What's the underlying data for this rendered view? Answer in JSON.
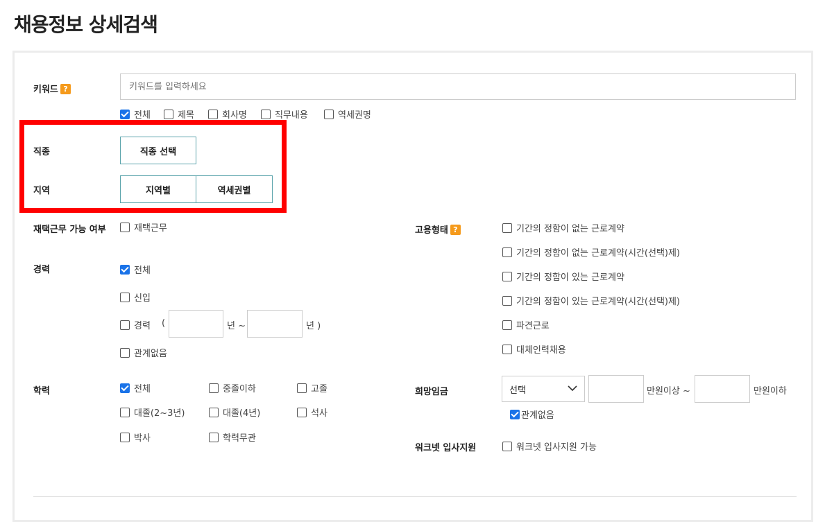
{
  "page_title": "채용정보 상세검색",
  "keyword": {
    "label": "키워드",
    "help": "?",
    "placeholder": "키워드를 입력하세요",
    "options": [
      {
        "label": "전체",
        "checked": true
      },
      {
        "label": "제목",
        "checked": false
      },
      {
        "label": "회사명",
        "checked": false
      },
      {
        "label": "직무내용",
        "checked": false
      },
      {
        "label": "역세권명",
        "checked": false
      }
    ]
  },
  "job_type": {
    "label": "직종",
    "button": "직종 선택"
  },
  "region": {
    "label": "지역",
    "by_region": "지역별",
    "by_station": "역세권별"
  },
  "remote": {
    "label": "재택근무 가능 여부",
    "option": "재택근무",
    "checked": false
  },
  "career": {
    "label": "경력",
    "all": "전체",
    "new": "신입",
    "experienced": "경력",
    "paren_open": "(",
    "year_tilde": "년 ~",
    "year_close": "년 )",
    "irrelevant": "관계없음"
  },
  "education": {
    "label": "학력",
    "options": [
      {
        "label": "전체",
        "checked": true
      },
      {
        "label": "중졸이하",
        "checked": false
      },
      {
        "label": "고졸",
        "checked": false
      },
      {
        "label": "대졸(2~3년)",
        "checked": false
      },
      {
        "label": "대졸(4년)",
        "checked": false
      },
      {
        "label": "석사",
        "checked": false
      },
      {
        "label": "박사",
        "checked": false
      },
      {
        "label": "학력무관",
        "checked": false
      }
    ]
  },
  "employment": {
    "label": "고용형태",
    "help": "?",
    "options": [
      "기간의 정함이 없는 근로계약",
      "기간의 정함이 없는 근로계약(시간(선택)제)",
      "기간의 정함이 있는 근로계약",
      "기간의 정함이 있는 근로계약(시간(선택)제)",
      "파견근로",
      "대체인력채용"
    ]
  },
  "salary": {
    "label": "희망임금",
    "select_value": "선택",
    "min_suffix": "만원이상 ~",
    "max_suffix": "만원이하",
    "irrelevant": "관계없음"
  },
  "worknet": {
    "label": "워크넷 입사지원",
    "option": "워크넷 입사지원 가능"
  },
  "colors": {
    "accent_check": "#1a73e8",
    "button_border": "#5aa3ab",
    "help_badge": "#f59a1b",
    "highlight_box": "#ff0000"
  }
}
